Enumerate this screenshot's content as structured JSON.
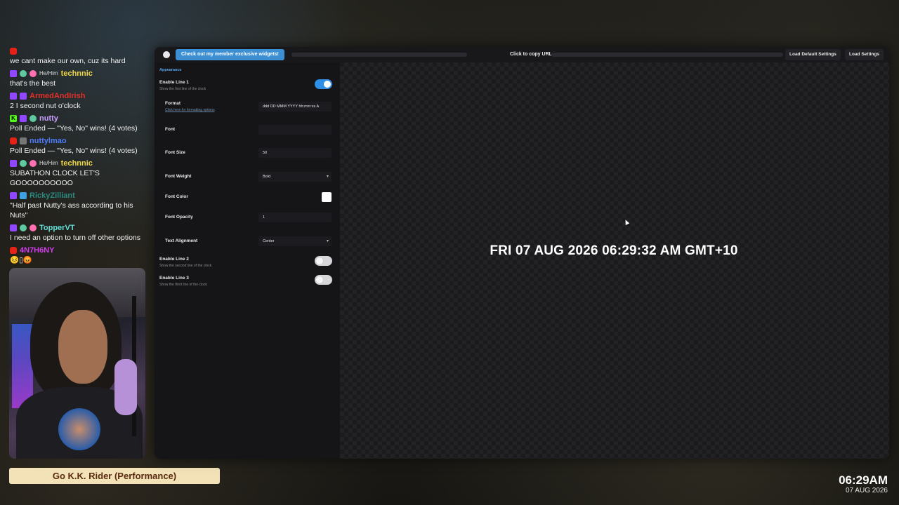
{
  "chat": {
    "messages": [
      {
        "user": "",
        "text": "we cant make our own, cuz its hard"
      },
      {
        "user": "technnic",
        "pronoun": "He/Him",
        "color": "#f0d840",
        "text": "that's the best"
      },
      {
        "user": "ArmedAndIrish",
        "color": "#e0302a",
        "text": "2 I second nut o'clock"
      },
      {
        "user": "nutty",
        "color": "#c9a0ff",
        "text": "Poll Ended — \"Yes, No\" wins! (4 votes)"
      },
      {
        "user": "nuttylmao",
        "color": "#4b7bff",
        "text": "Poll Ended — \"Yes, No\" wins! (4 votes)"
      },
      {
        "user": "technnic",
        "pronoun": "He/Him",
        "color": "#f0d840",
        "text": "SUBATHON CLOCK LET'S GOOOOOOOOOO"
      },
      {
        "user": "RickyZilliant",
        "color": "#2a8a80",
        "text": "\"Half past Nutty's ass according to his Nuts\""
      },
      {
        "user": "TopperVT",
        "color": "#5fe0d8",
        "text": "I need an option to turn off other options"
      },
      {
        "user": "4N7H6NY",
        "color": "#d33cf0",
        "text": "😣▯😡"
      }
    ]
  },
  "now_playing": "Go K.K. Rider (Performance)",
  "mini_clock": {
    "time": "06:29AM",
    "date": "07 AUG 2026"
  },
  "toolbar": {
    "promo_label": "Check out my member exclusive widgets!",
    "copy_url_label": "Click to copy URL",
    "load_default_label": "Load Default Settings",
    "load_settings_label": "Load Settings"
  },
  "settings": {
    "section_title": "Appearance",
    "line1": {
      "label": "Enable Line 1",
      "sub": "Show the first line of the clock",
      "enabled": true
    },
    "format": {
      "label": "Format",
      "link": "Click here for formatting options",
      "value": "ddd DD MMM YYYY hh:mm:ss A"
    },
    "font": {
      "label": "Font",
      "value": ""
    },
    "font_size": {
      "label": "Font Size",
      "value": "50"
    },
    "font_weight": {
      "label": "Font Weight",
      "value": "Bold"
    },
    "font_color": {
      "label": "Font Color",
      "value": "#ffffff"
    },
    "font_opacity": {
      "label": "Font Opacity",
      "value": "1"
    },
    "text_alignment": {
      "label": "Text Alignment",
      "value": "Center"
    },
    "line2": {
      "label": "Enable Line 2",
      "sub": "Show the second line of the clock",
      "enabled": false
    },
    "line3": {
      "label": "Enable Line 3",
      "sub": "Show the third line of the clock",
      "enabled": false
    }
  },
  "preview": {
    "clock_text": "FRI 07 AUG 2026 06:29:32 AM GMT+10"
  },
  "icons": {
    "logo": "teapot-logo-icon",
    "dropdown": "chevron-down-icon"
  }
}
